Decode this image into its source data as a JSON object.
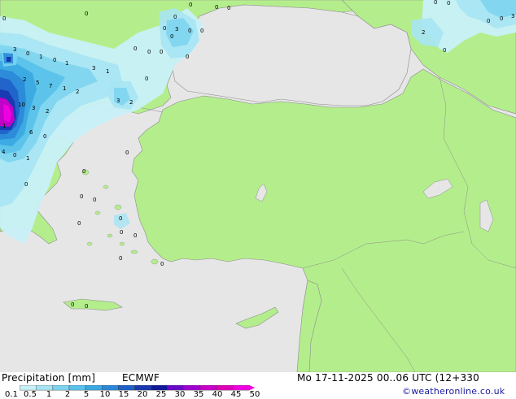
{
  "map": {
    "labels": [
      {
        "text": "0"
      },
      {
        "text": "0"
      },
      {
        "text": "0"
      },
      {
        "text": "0"
      },
      {
        "text": "0"
      },
      {
        "text": "0"
      },
      {
        "text": "0"
      },
      {
        "text": "3"
      },
      {
        "text": "0"
      },
      {
        "text": "0"
      },
      {
        "text": "3"
      },
      {
        "text": "0"
      },
      {
        "text": "1"
      },
      {
        "text": "0"
      },
      {
        "text": "1"
      },
      {
        "text": "3"
      },
      {
        "text": "1"
      },
      {
        "text": "0"
      },
      {
        "text": "0"
      },
      {
        "text": "2"
      },
      {
        "text": "5"
      },
      {
        "text": "7"
      },
      {
        "text": "1"
      },
      {
        "text": "2"
      },
      {
        "text": "3"
      },
      {
        "text": "2"
      },
      {
        "text": "10"
      },
      {
        "text": "3"
      },
      {
        "text": "2"
      },
      {
        "text": "1"
      },
      {
        "text": "6"
      },
      {
        "text": "0"
      },
      {
        "text": "4"
      },
      {
        "text": "0"
      },
      {
        "text": "1"
      },
      {
        "text": "0"
      },
      {
        "text": "0"
      },
      {
        "text": "0"
      },
      {
        "text": "0"
      },
      {
        "text": "0"
      },
      {
        "text": "0"
      },
      {
        "text": "0"
      },
      {
        "text": "0"
      },
      {
        "text": "0"
      },
      {
        "text": "0"
      },
      {
        "text": "0"
      },
      {
        "text": "0"
      },
      {
        "text": "0"
      },
      {
        "text": "2"
      },
      {
        "text": "0"
      },
      {
        "text": "0"
      },
      {
        "text": "0"
      },
      {
        "text": "0"
      },
      {
        "text": "3"
      },
      {
        "text": "0"
      },
      {
        "text": "0"
      },
      {
        "text": "0"
      },
      {
        "text": "0"
      },
      {
        "text": "0"
      }
    ]
  },
  "legend": {
    "title": "Precipitation [mm]",
    "model": "ECMWF",
    "datetime": "Mo 17-11-2025 00..06 UTC (12+330",
    "credit": "©weatheronline.co.uk",
    "scale_labels": [
      "0.1",
      "0.5",
      "1",
      "2",
      "5",
      "10",
      "15",
      "20",
      "25",
      "30",
      "35",
      "40",
      "45",
      "50"
    ],
    "scale_colors": [
      "#c8f0f8",
      "#a6e4f4",
      "#7dd4f0",
      "#58c2ea",
      "#3aa8e2",
      "#2a88d8",
      "#2060c8",
      "#1838b0",
      "#10189a",
      "#6a0ac8",
      "#a000d0",
      "#c800c8",
      "#e000b8",
      "#f000e0"
    ]
  }
}
